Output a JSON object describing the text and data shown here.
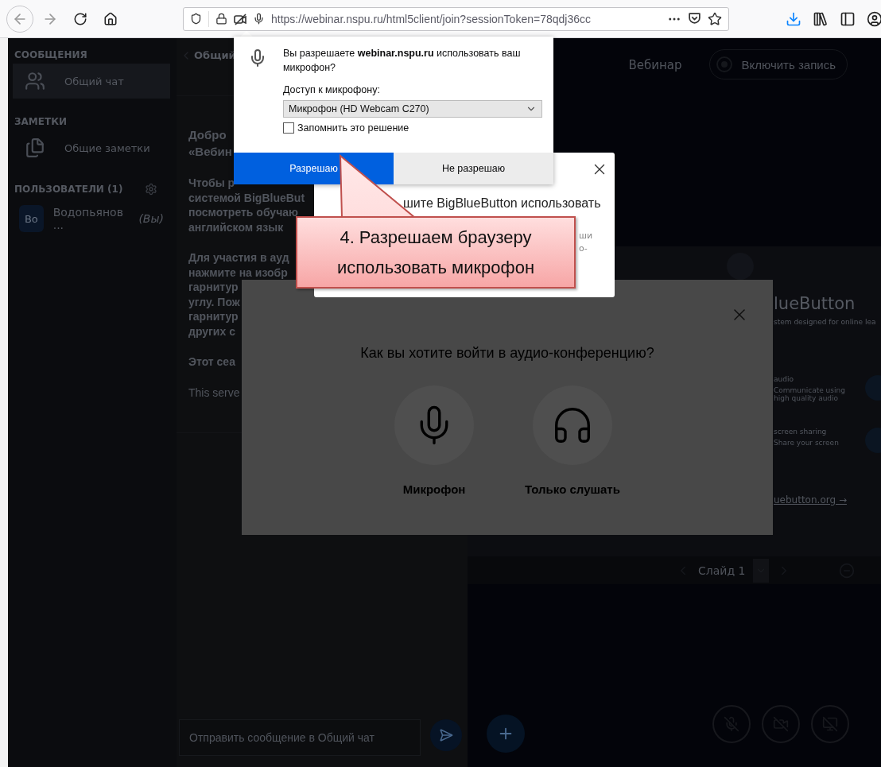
{
  "browser_toolbar": {
    "url": "https://webinar.nspu.ru/html5client/join?sessionToken=78qdj36cc"
  },
  "sidebar": {
    "sections": [
      {
        "title": "СООБЩЕНИЯ",
        "items": [
          {
            "kind": "chat",
            "label": "Общий чат",
            "selected": true
          }
        ]
      },
      {
        "title": "ЗАМЕТКИ",
        "items": [
          {
            "kind": "notes",
            "label": "Общие заметки",
            "selected": false
          }
        ]
      }
    ],
    "users": {
      "title": "ПОЛЬЗОВАТЕЛИ (1)",
      "items": [
        {
          "avatar": "Во",
          "name": "Водопьянов ...",
          "suffix": "(Вы)"
        }
      ]
    }
  },
  "chat": {
    "header": "Общий",
    "paragraphs": [
      {
        "kind": "heading",
        "lines": [
          "Добро",
          "«Вебин"
        ]
      },
      {
        "kind": "bold",
        "lines": [
          "Чтобы р",
          "системой BigBlueBut",
          "посмотреть обучаю",
          "английском язык"
        ]
      },
      {
        "kind": "bold",
        "lines": [
          "Для участия в ауд",
          "нажмите на изобр",
          "гарнитур",
          "углу. Пож",
          "гарнитур",
          "других с"
        ]
      },
      {
        "kind": "bold",
        "lines": [
          "Этот сеа"
        ]
      },
      {
        "kind": "normal",
        "lines": [
          "This serve"
        ]
      }
    ],
    "input_placeholder": "Отправить сообщение в Общий чат"
  },
  "presentation": {
    "title": "Вебинар",
    "record_button": "Включить запись",
    "slide": {
      "heading": "lueButton",
      "subtitle": "stem designed for online lea",
      "features": [
        {
          "title": "audio",
          "text": "Communicate using high quality audio"
        },
        {
          "title": "screen sharing",
          "text": "Share your screen"
        }
      ],
      "link": "uebutton.org →"
    },
    "slide_label": "Слайд 1"
  },
  "audio_modal": {
    "title": "Как вы хотите войти в аудио-конференцию?",
    "options": [
      {
        "kind": "microphone",
        "label": "Микрофон"
      },
      {
        "kind": "listen",
        "label": "Только слушать"
      }
    ]
  },
  "hint_dialog": {
    "text": "шите BigBlueButton использовать",
    "fragments": [
      "ши",
      "о-"
    ]
  },
  "permission_popup": {
    "question": "Вы разрешаете **webinar.nspu.ru** использовать ваш микрофон?",
    "access_label": "Доступ к микрофону:",
    "device": "Микрофон (HD Webcam C270)",
    "remember": {
      "label": "Запомнить это решение",
      "checked": false
    },
    "buttons": [
      {
        "kind": "primary",
        "label": "Разрешаю"
      },
      {
        "kind": "secondary",
        "label": "Не разрешаю"
      }
    ]
  },
  "callout": {
    "text": "4. Разрешаем браузеру использовать микрофон"
  }
}
